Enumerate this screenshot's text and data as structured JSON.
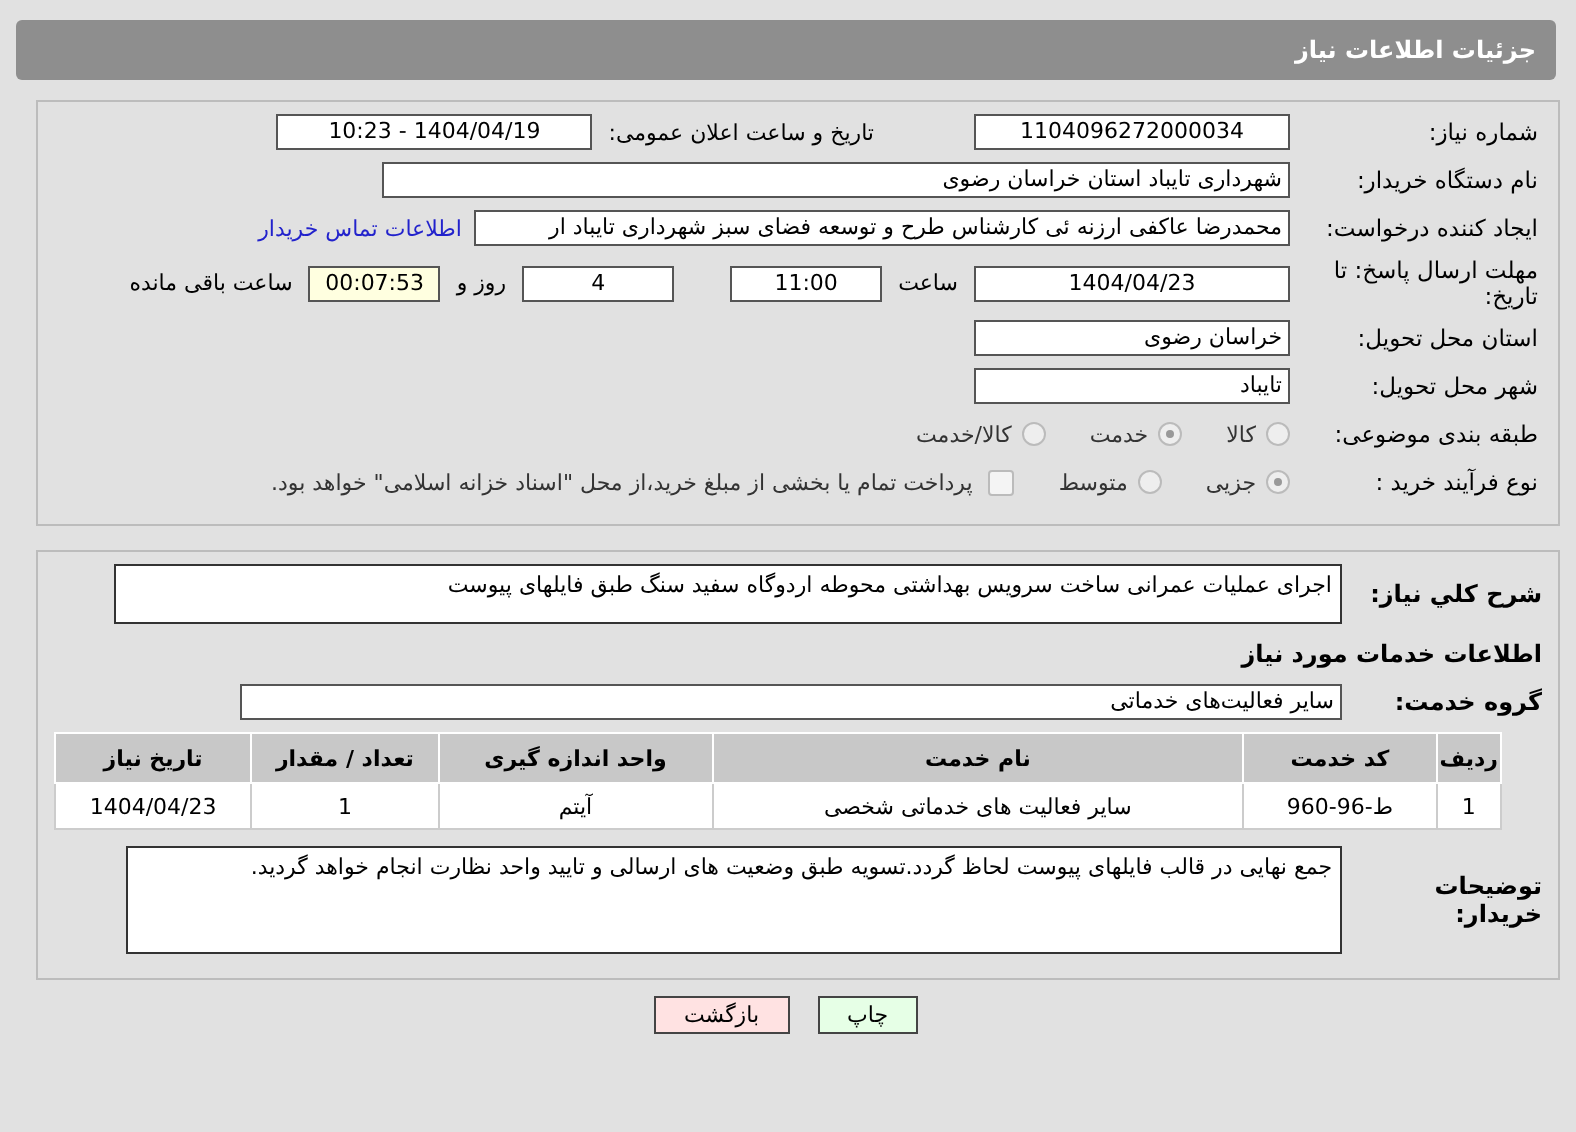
{
  "header": {
    "title": "جزئیات اطلاعات نیاز"
  },
  "need_number": {
    "label": "شماره نیاز:",
    "value": "1104096272000034"
  },
  "announce": {
    "label": "تاریخ و ساعت اعلان عمومی:",
    "value": "1404/04/19 - 10:23"
  },
  "buyer_org": {
    "label": "نام دستگاه خریدار:",
    "value": "شهرداری تایباد استان خراسان رضوی"
  },
  "requester": {
    "label": "ایجاد کننده درخواست:",
    "value": "محمدرضا عاکفی ارزنه ئی کارشناس طرح و توسعه فضای سبز شهرداری تایباد ار",
    "link": "اطلاعات تماس خریدار"
  },
  "deadline": {
    "label": "مهلت ارسال پاسخ: تا تاریخ:",
    "date": "1404/04/23",
    "time_label": "ساعت",
    "time": "11:00",
    "days": "4",
    "days_label": "روز و",
    "remaining": "00:07:53",
    "remaining_label": "ساعت باقی مانده"
  },
  "province": {
    "label": "استان محل تحویل:",
    "value": "خراسان رضوی"
  },
  "city": {
    "label": "شهر محل تحویل:",
    "value": "تایباد"
  },
  "category": {
    "label": "طبقه بندی موضوعی:",
    "options": [
      {
        "label": "کالا",
        "selected": false
      },
      {
        "label": "خدمت",
        "selected": true
      },
      {
        "label": "کالا/خدمت",
        "selected": false
      }
    ]
  },
  "process": {
    "label": "نوع فرآیند خرید :",
    "options": [
      {
        "label": "جزیی",
        "selected": true
      },
      {
        "label": "متوسط",
        "selected": false
      }
    ],
    "payment": {
      "checked": false,
      "text": "پرداخت تمام یا بخشی از مبلغ خرید،از محل \"اسناد خزانه اسلامی\" خواهد بود."
    }
  },
  "description": {
    "label": "شرح کلي نياز:",
    "value": "اجرای عملیات عمرانی ساخت سرویس بهداشتی محوطه اردوگاه سفید سنگ طبق فایلهای پیوست"
  },
  "services_heading": "اطلاعات خدمات مورد نیاز",
  "service_group": {
    "label": "گروه خدمت:",
    "value": "سایر فعالیت‌های خدماتی"
  },
  "table": {
    "columns": [
      "ردیف",
      "کد خدمت",
      "نام خدمت",
      "واحد اندازه گیری",
      "تعداد / مقدار",
      "تاریخ نیاز"
    ],
    "rows": [
      [
        "1",
        "ط-96-960",
        "سایر فعالیت های خدماتی شخصی",
        "آیتم",
        "1",
        "1404/04/23"
      ]
    ]
  },
  "buyer_notes": {
    "label": "توضیحات خریدار:",
    "value": "جمع نهایی در قالب فایلهای پیوست لحاظ گردد.تسویه طبق وضعیت های ارسالی و تایید واحد نظارت انجام خواهد گردید."
  },
  "buttons": [
    {
      "label": "چاپ",
      "kind": "print"
    },
    {
      "label": "بازگشت",
      "kind": "back"
    }
  ]
}
